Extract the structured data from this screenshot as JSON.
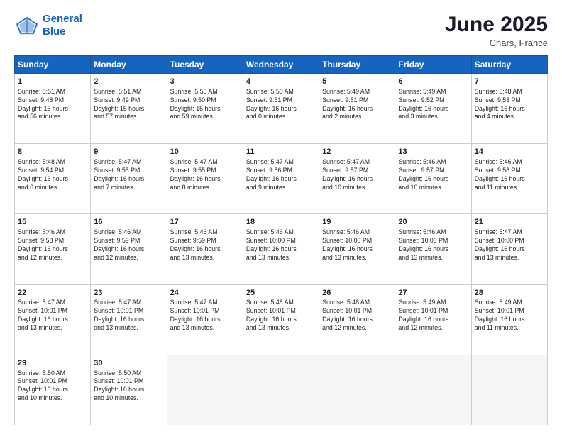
{
  "header": {
    "logo_line1": "General",
    "logo_line2": "Blue",
    "month": "June 2025",
    "location": "Chars, France"
  },
  "days_of_week": [
    "Sunday",
    "Monday",
    "Tuesday",
    "Wednesday",
    "Thursday",
    "Friday",
    "Saturday"
  ],
  "weeks": [
    [
      {
        "day": 1,
        "lines": [
          "Sunrise: 5:51 AM",
          "Sunset: 9:48 PM",
          "Daylight: 15 hours",
          "and 56 minutes."
        ]
      },
      {
        "day": 2,
        "lines": [
          "Sunrise: 5:51 AM",
          "Sunset: 9:49 PM",
          "Daylight: 15 hours",
          "and 57 minutes."
        ]
      },
      {
        "day": 3,
        "lines": [
          "Sunrise: 5:50 AM",
          "Sunset: 9:50 PM",
          "Daylight: 15 hours",
          "and 59 minutes."
        ]
      },
      {
        "day": 4,
        "lines": [
          "Sunrise: 5:50 AM",
          "Sunset: 9:51 PM",
          "Daylight: 16 hours",
          "and 0 minutes."
        ]
      },
      {
        "day": 5,
        "lines": [
          "Sunrise: 5:49 AM",
          "Sunset: 9:51 PM",
          "Daylight: 16 hours",
          "and 2 minutes."
        ]
      },
      {
        "day": 6,
        "lines": [
          "Sunrise: 5:49 AM",
          "Sunset: 9:52 PM",
          "Daylight: 16 hours",
          "and 3 minutes."
        ]
      },
      {
        "day": 7,
        "lines": [
          "Sunrise: 5:48 AM",
          "Sunset: 9:53 PM",
          "Daylight: 16 hours",
          "and 4 minutes."
        ]
      }
    ],
    [
      {
        "day": 8,
        "lines": [
          "Sunrise: 5:48 AM",
          "Sunset: 9:54 PM",
          "Daylight: 16 hours",
          "and 6 minutes."
        ]
      },
      {
        "day": 9,
        "lines": [
          "Sunrise: 5:47 AM",
          "Sunset: 9:55 PM",
          "Daylight: 16 hours",
          "and 7 minutes."
        ]
      },
      {
        "day": 10,
        "lines": [
          "Sunrise: 5:47 AM",
          "Sunset: 9:55 PM",
          "Daylight: 16 hours",
          "and 8 minutes."
        ]
      },
      {
        "day": 11,
        "lines": [
          "Sunrise: 5:47 AM",
          "Sunset: 9:56 PM",
          "Daylight: 16 hours",
          "and 9 minutes."
        ]
      },
      {
        "day": 12,
        "lines": [
          "Sunrise: 5:47 AM",
          "Sunset: 9:57 PM",
          "Daylight: 16 hours",
          "and 10 minutes."
        ]
      },
      {
        "day": 13,
        "lines": [
          "Sunrise: 5:46 AM",
          "Sunset: 9:57 PM",
          "Daylight: 16 hours",
          "and 10 minutes."
        ]
      },
      {
        "day": 14,
        "lines": [
          "Sunrise: 5:46 AM",
          "Sunset: 9:58 PM",
          "Daylight: 16 hours",
          "and 11 minutes."
        ]
      }
    ],
    [
      {
        "day": 15,
        "lines": [
          "Sunrise: 5:46 AM",
          "Sunset: 9:58 PM",
          "Daylight: 16 hours",
          "and 12 minutes."
        ]
      },
      {
        "day": 16,
        "lines": [
          "Sunrise: 5:46 AM",
          "Sunset: 9:59 PM",
          "Daylight: 16 hours",
          "and 12 minutes."
        ]
      },
      {
        "day": 17,
        "lines": [
          "Sunrise: 5:46 AM",
          "Sunset: 9:59 PM",
          "Daylight: 16 hours",
          "and 13 minutes."
        ]
      },
      {
        "day": 18,
        "lines": [
          "Sunrise: 5:46 AM",
          "Sunset: 10:00 PM",
          "Daylight: 16 hours",
          "and 13 minutes."
        ]
      },
      {
        "day": 19,
        "lines": [
          "Sunrise: 5:46 AM",
          "Sunset: 10:00 PM",
          "Daylight: 16 hours",
          "and 13 minutes."
        ]
      },
      {
        "day": 20,
        "lines": [
          "Sunrise: 5:46 AM",
          "Sunset: 10:00 PM",
          "Daylight: 16 hours",
          "and 13 minutes."
        ]
      },
      {
        "day": 21,
        "lines": [
          "Sunrise: 5:47 AM",
          "Sunset: 10:00 PM",
          "Daylight: 16 hours",
          "and 13 minutes."
        ]
      }
    ],
    [
      {
        "day": 22,
        "lines": [
          "Sunrise: 5:47 AM",
          "Sunset: 10:01 PM",
          "Daylight: 16 hours",
          "and 13 minutes."
        ]
      },
      {
        "day": 23,
        "lines": [
          "Sunrise: 5:47 AM",
          "Sunset: 10:01 PM",
          "Daylight: 16 hours",
          "and 13 minutes."
        ]
      },
      {
        "day": 24,
        "lines": [
          "Sunrise: 5:47 AM",
          "Sunset: 10:01 PM",
          "Daylight: 16 hours",
          "and 13 minutes."
        ]
      },
      {
        "day": 25,
        "lines": [
          "Sunrise: 5:48 AM",
          "Sunset: 10:01 PM",
          "Daylight: 16 hours",
          "and 13 minutes."
        ]
      },
      {
        "day": 26,
        "lines": [
          "Sunrise: 5:48 AM",
          "Sunset: 10:01 PM",
          "Daylight: 16 hours",
          "and 12 minutes."
        ]
      },
      {
        "day": 27,
        "lines": [
          "Sunrise: 5:49 AM",
          "Sunset: 10:01 PM",
          "Daylight: 16 hours",
          "and 12 minutes."
        ]
      },
      {
        "day": 28,
        "lines": [
          "Sunrise: 5:49 AM",
          "Sunset: 10:01 PM",
          "Daylight: 16 hours",
          "and 11 minutes."
        ]
      }
    ],
    [
      {
        "day": 29,
        "lines": [
          "Sunrise: 5:50 AM",
          "Sunset: 10:01 PM",
          "Daylight: 16 hours",
          "and 10 minutes."
        ]
      },
      {
        "day": 30,
        "lines": [
          "Sunrise: 5:50 AM",
          "Sunset: 10:01 PM",
          "Daylight: 16 hours",
          "and 10 minutes."
        ]
      },
      null,
      null,
      null,
      null,
      null
    ]
  ]
}
